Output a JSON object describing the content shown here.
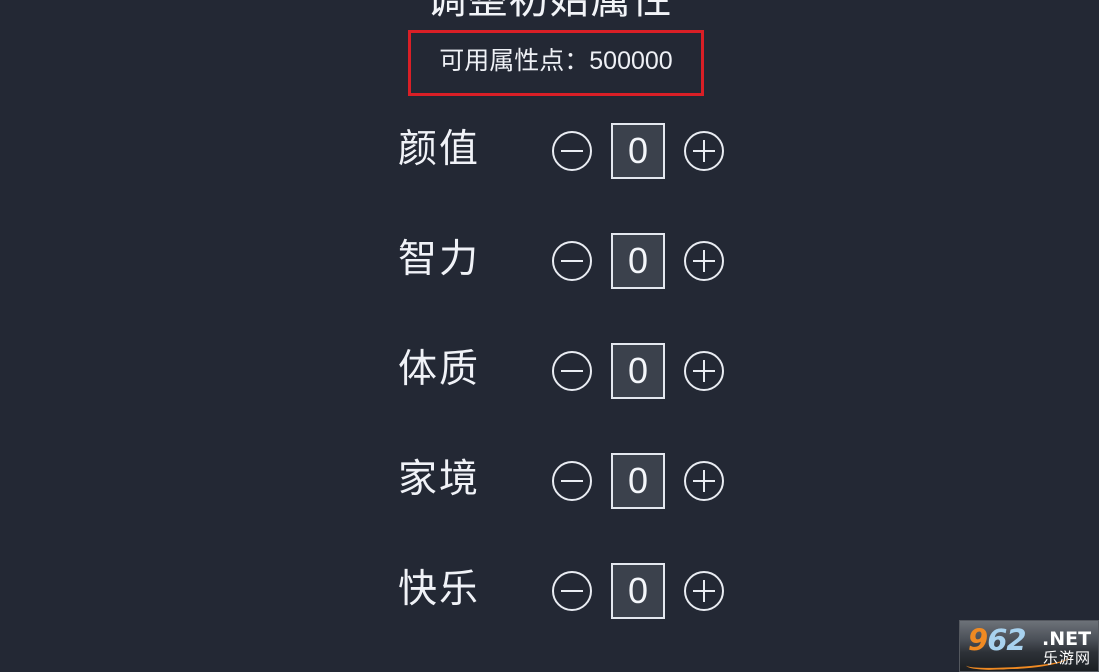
{
  "screen": {
    "background_color": "#232834",
    "title": "调整初始属性"
  },
  "points_panel": {
    "highlight_color": "#d91f26",
    "label": "可用属性点：500000",
    "points_value": "500000"
  },
  "attributes": {
    "decrement_icon": "minus-circle-icon",
    "increment_icon": "plus-circle-icon",
    "rows": [
      {
        "label": "颜值",
        "value": "0"
      },
      {
        "label": "智力",
        "value": "0"
      },
      {
        "label": "体质",
        "value": "0"
      },
      {
        "label": "家境",
        "value": "0"
      },
      {
        "label": "快乐",
        "value": "0"
      }
    ]
  },
  "watermark": {
    "brand_prefix": "9",
    "brand_suffix": "62",
    "domain": "'.NET'",
    "domain_text": ".NET",
    "cn_name": "乐游网"
  }
}
